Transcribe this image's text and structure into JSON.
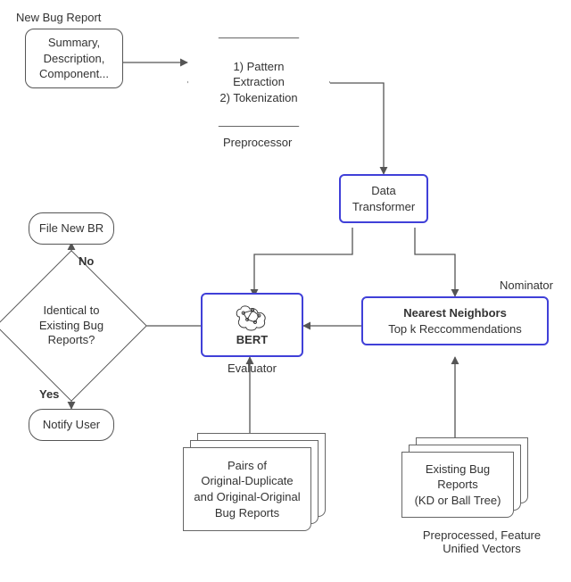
{
  "chart_data": {
    "type": "diagram",
    "title": "",
    "nodes": [
      {
        "id": "new_bug_report_label",
        "type": "label",
        "text": "New Bug Report"
      },
      {
        "id": "new_bug_report_doc",
        "type": "document",
        "text": "Summary,\nDescription,\nComponent..."
      },
      {
        "id": "preprocessor",
        "type": "hexagon",
        "text": "1) Pattern Extraction\n2) Tokenization",
        "caption": "Preprocessor"
      },
      {
        "id": "data_transformer",
        "type": "process",
        "text": "Data\nTransformer"
      },
      {
        "id": "nominator_label",
        "type": "label",
        "text": "Nominator"
      },
      {
        "id": "nearest_neighbors",
        "type": "process",
        "text": "Nearest Neighbors\nTop k Reccommendations"
      },
      {
        "id": "evaluator",
        "type": "process",
        "text": "BERT",
        "caption": "Evaluator",
        "icon": "brain"
      },
      {
        "id": "decision",
        "type": "decision",
        "text": "Identical to\nExisting Bug\nReports?"
      },
      {
        "id": "file_new_br",
        "type": "terminal",
        "text": "File New BR"
      },
      {
        "id": "notify_user",
        "type": "terminal",
        "text": "Notify User"
      },
      {
        "id": "pairs_stack",
        "type": "datastack",
        "text": "Pairs of\nOriginal-Duplicate\nand Original-Original\nBug Reports"
      },
      {
        "id": "existing_stack",
        "type": "datastack",
        "text": "Existing Bug\nReports\n(KD or Ball Tree)",
        "caption": "Preprocessed, Feature\nUnified Vectors"
      }
    ],
    "edges": [
      {
        "from": "new_bug_report_doc",
        "to": "preprocessor"
      },
      {
        "from": "preprocessor",
        "to": "data_transformer"
      },
      {
        "from": "data_transformer",
        "to": "evaluator"
      },
      {
        "from": "data_transformer",
        "to": "nearest_neighbors"
      },
      {
        "from": "nearest_neighbors",
        "to": "evaluator"
      },
      {
        "from": "evaluator",
        "to": "decision"
      },
      {
        "from": "decision",
        "to": "file_new_br",
        "label": "No"
      },
      {
        "from": "decision",
        "to": "notify_user",
        "label": "Yes"
      },
      {
        "from": "pairs_stack",
        "to": "evaluator"
      },
      {
        "from": "existing_stack",
        "to": "nearest_neighbors"
      }
    ]
  },
  "labels": {
    "new_bug_report": "New Bug Report",
    "nominator": "Nominator",
    "preprocessor_caption": "Preprocessor",
    "evaluator_caption": "Evaluator",
    "vectors_caption_l1": "Preprocessed, Feature",
    "vectors_caption_l2": "Unified Vectors",
    "no": "No",
    "yes": "Yes"
  },
  "doc": {
    "l1": "Summary,",
    "l2": "Description,",
    "l3": "Component..."
  },
  "hex": {
    "l1": "1) Pattern Extraction",
    "l2": "2) Tokenization"
  },
  "data_transformer": {
    "l1": "Data",
    "l2": "Transformer"
  },
  "nn": {
    "title": "Nearest Neighbors",
    "sub": "Top k Reccommendations"
  },
  "evaluator": {
    "title": "BERT"
  },
  "decision": {
    "l1": "Identical to",
    "l2": "Existing Bug",
    "l3": "Reports?"
  },
  "file_new_br": "File New BR",
  "notify_user": "Notify User",
  "pairs": {
    "l1": "Pairs of",
    "l2": "Original-Duplicate",
    "l3": "and Original-Original",
    "l4": "Bug Reports"
  },
  "existing": {
    "l1": "Existing Bug",
    "l2": "Reports",
    "l3": "(KD or Ball Tree)"
  }
}
